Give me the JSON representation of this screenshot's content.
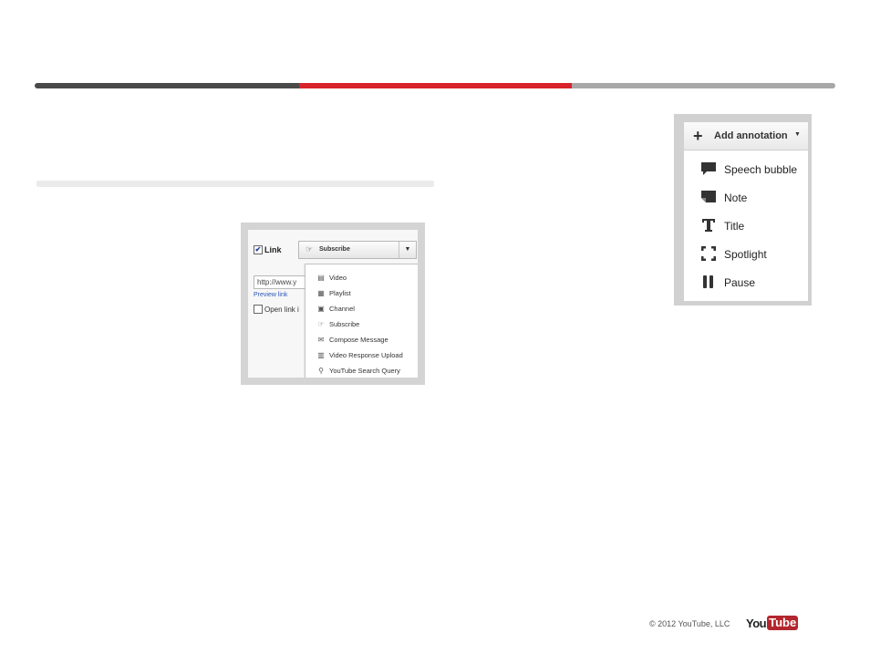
{
  "colors": {
    "accent": "#d8232a",
    "dark": "#4a4a4a",
    "light": "#a8a8a8"
  },
  "link_editor": {
    "checkbox_label": "Link",
    "url_value": "http://www.y",
    "preview_link": "Preview link",
    "open_link_label": "Open link i",
    "selected": {
      "icon": "subscribe-icon",
      "label": "Subscribe"
    },
    "menu": [
      {
        "icon": "video-icon",
        "label": "Video"
      },
      {
        "icon": "playlist-icon",
        "label": "Playlist"
      },
      {
        "icon": "channel-icon",
        "label": "Channel"
      },
      {
        "icon": "subscribe-icon",
        "label": "Subscribe"
      },
      {
        "icon": "compose-message-icon",
        "label": "Compose Message"
      },
      {
        "icon": "video-response-upload-icon",
        "label": "Video Response Upload"
      },
      {
        "icon": "search-icon",
        "label": "YouTube Search Query"
      }
    ]
  },
  "annotation_menu": {
    "title": "Add annotation",
    "items": [
      {
        "icon": "speech-bubble-icon",
        "label": "Speech bubble"
      },
      {
        "icon": "note-icon",
        "label": "Note"
      },
      {
        "icon": "title-icon",
        "label": "Title"
      },
      {
        "icon": "spotlight-icon",
        "label": "Spotlight"
      },
      {
        "icon": "pause-icon",
        "label": "Pause"
      }
    ]
  },
  "footer": {
    "copyright": "© 2012 YouTube, LLC",
    "logo_you": "You",
    "logo_tube": "Tube"
  }
}
